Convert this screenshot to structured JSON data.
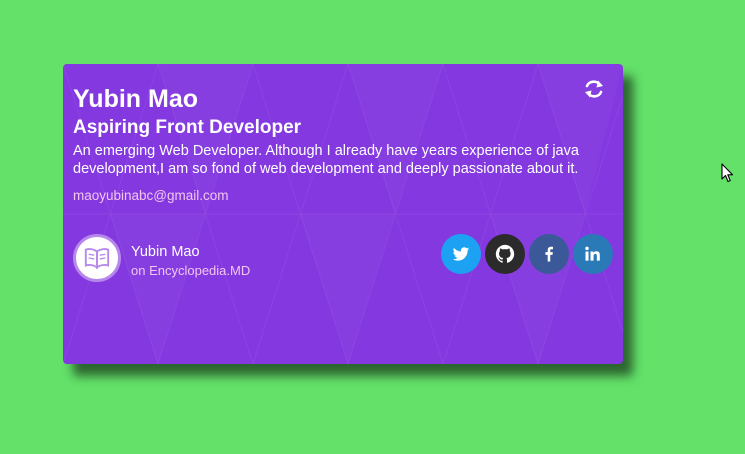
{
  "card": {
    "name": "Yubin Mao",
    "title": "Aspiring Front Developer",
    "bio": "An emerging Web Developer. Although I already have years experience of java development,I am so fond of web development and deeply passionate about it.",
    "email": "maoyubinabc@gmail.com",
    "flip_icon": "flip-refresh-icon"
  },
  "author": {
    "name": "Yubin Mao",
    "source": "on Encyclopedia.MD",
    "avatar_icon": "open-book-icon"
  },
  "social": [
    {
      "name": "twitter",
      "icon": "twitter-icon",
      "color": "#1da1f2"
    },
    {
      "name": "github",
      "icon": "github-icon",
      "color": "#2b2b2b"
    },
    {
      "name": "facebook",
      "icon": "facebook-icon",
      "color": "#3b5998"
    },
    {
      "name": "linkedin",
      "icon": "linkedin-icon",
      "color": "#2a7ab8"
    }
  ],
  "colors": {
    "background": "#63e169",
    "card": "#8438e0",
    "accent_text": "#f2c6f0"
  }
}
